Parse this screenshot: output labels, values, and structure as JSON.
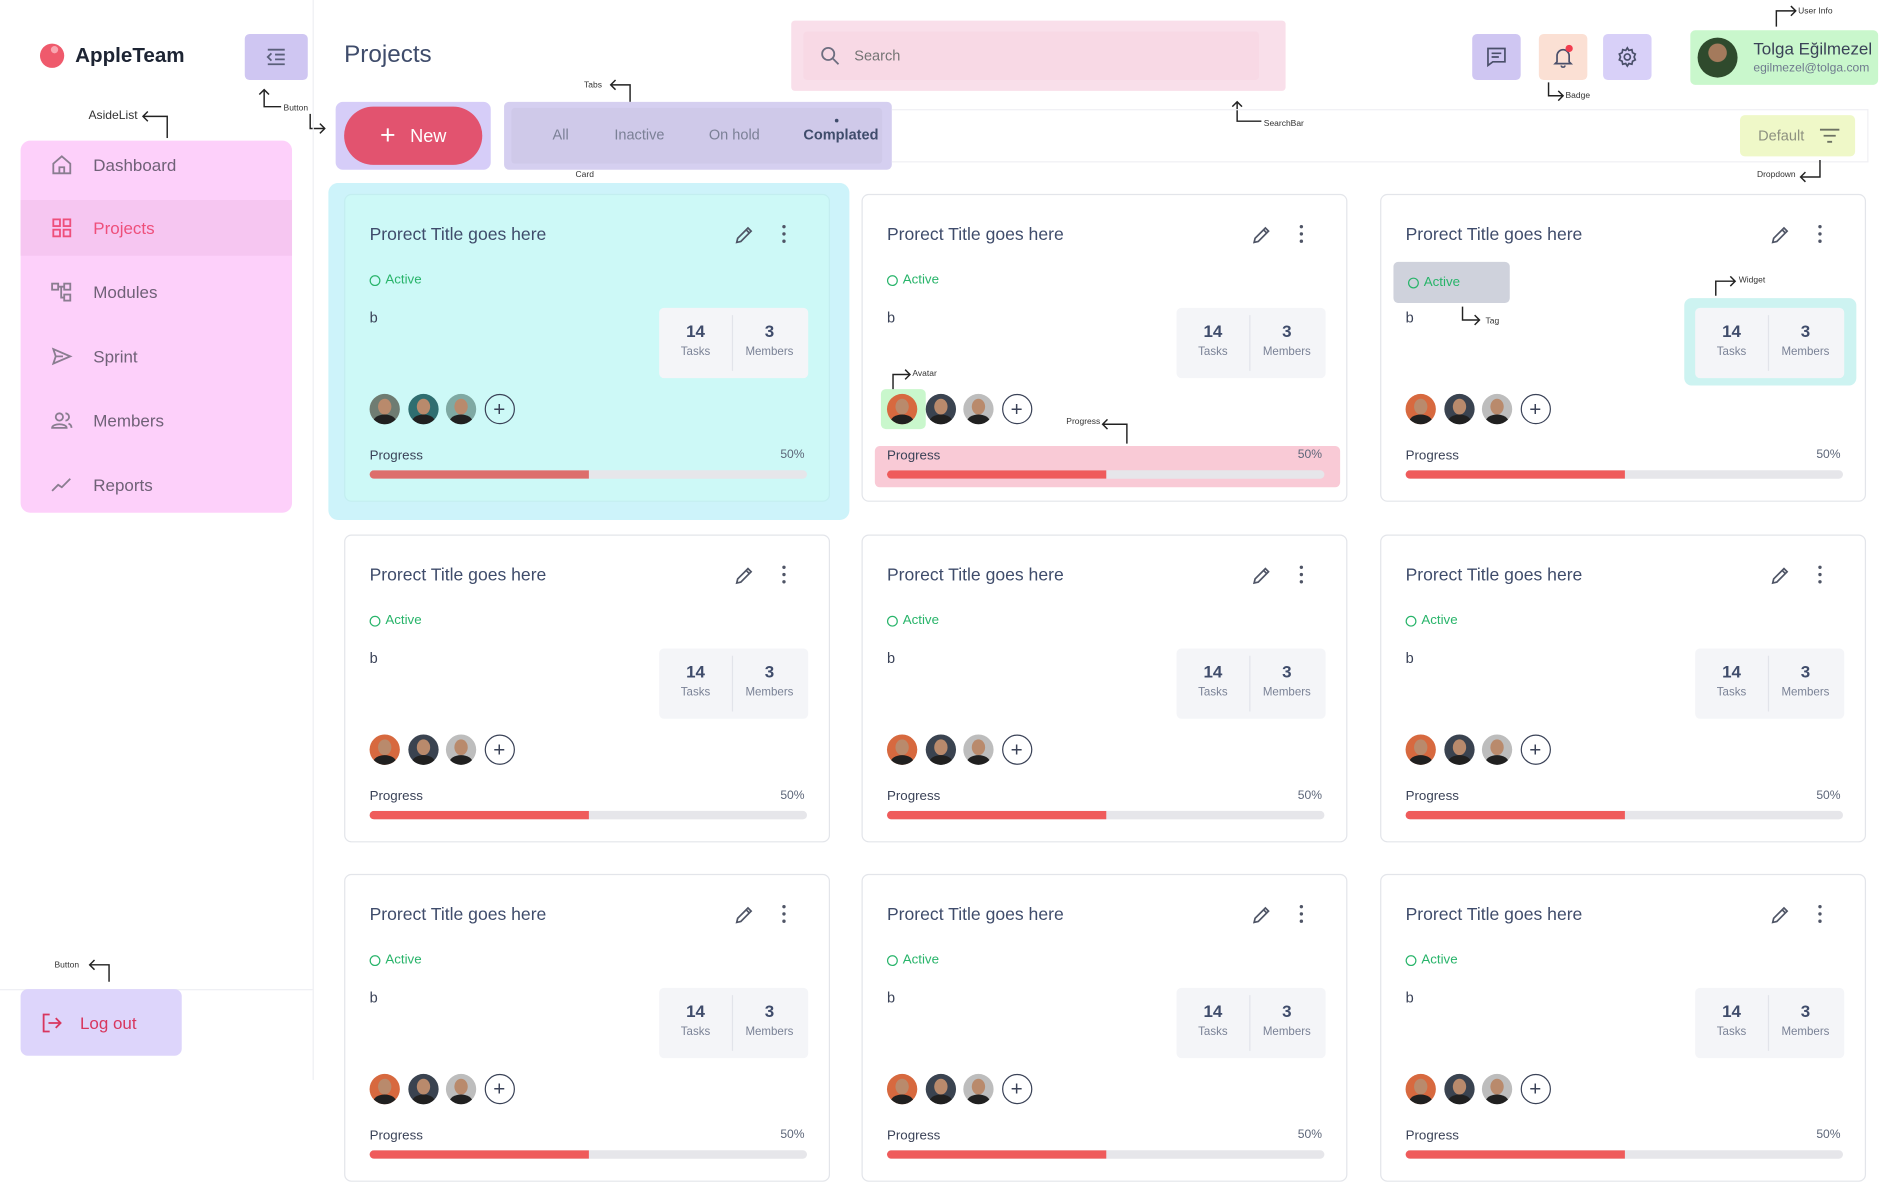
{
  "app": {
    "name": "AppleTeam"
  },
  "sidebar": {
    "items": [
      {
        "label": "Dashboard",
        "icon": "home-icon",
        "active": false
      },
      {
        "label": "Projects",
        "icon": "grid-icon",
        "active": true
      },
      {
        "label": "Modules",
        "icon": "modules-icon",
        "active": false
      },
      {
        "label": "Sprint",
        "icon": "send-icon",
        "active": false
      },
      {
        "label": "Members",
        "icon": "members-icon",
        "active": false
      },
      {
        "label": "Reports",
        "icon": "trend-icon",
        "active": false
      }
    ],
    "logout_label": "Log out"
  },
  "header": {
    "title": "Projects",
    "search": {
      "placeholder": "Search",
      "value": ""
    },
    "user": {
      "name": "Tolga Eğilmezel",
      "email": "egilmezel@tolga.com"
    }
  },
  "toolbar": {
    "new_label": "New",
    "tabs": [
      {
        "label": "All",
        "active": false
      },
      {
        "label": "Inactive",
        "active": false
      },
      {
        "label": "On hold",
        "active": false
      },
      {
        "label": "Complated",
        "active": true
      }
    ],
    "sort": {
      "value": "Default"
    }
  },
  "annotations": {
    "aside_list": "AsideList",
    "button_1": "Button",
    "button_2": "Button",
    "tabs": "Tabs",
    "card": "Card",
    "search_bar": "SearchBar",
    "badge": "Badge",
    "user_info": "User Info",
    "dropdown": "Dropdown",
    "widget": "Widget",
    "tag": "Tag",
    "avatar": "Avatar",
    "progress": "Progress"
  },
  "cards": [
    {
      "title": "Prorect Title goes here",
      "status": "Active",
      "description": "b",
      "tasks": "14",
      "tasks_label": "Tasks",
      "members": "3",
      "members_label": "Members",
      "progress_label": "Progress",
      "progress_text": "50%",
      "progress": 0.5
    },
    {
      "title": "Prorect Title goes here",
      "status": "Active",
      "description": "b",
      "tasks": "14",
      "tasks_label": "Tasks",
      "members": "3",
      "members_label": "Members",
      "progress_label": "Progress",
      "progress_text": "50%",
      "progress": 0.5
    },
    {
      "title": "Prorect Title goes here",
      "status": "Active",
      "description": "b",
      "tasks": "14",
      "tasks_label": "Tasks",
      "members": "3",
      "members_label": "Members",
      "progress_label": "Progress",
      "progress_text": "50%",
      "progress": 0.5
    },
    {
      "title": "Prorect Title goes here",
      "status": "Active",
      "description": "b",
      "tasks": "14",
      "tasks_label": "Tasks",
      "members": "3",
      "members_label": "Members",
      "progress_label": "Progress",
      "progress_text": "50%",
      "progress": 0.5
    },
    {
      "title": "Prorect Title goes here",
      "status": "Active",
      "description": "b",
      "tasks": "14",
      "tasks_label": "Tasks",
      "members": "3",
      "members_label": "Members",
      "progress_label": "Progress",
      "progress_text": "50%",
      "progress": 0.5
    },
    {
      "title": "Prorect Title goes here",
      "status": "Active",
      "description": "b",
      "tasks": "14",
      "tasks_label": "Tasks",
      "members": "3",
      "members_label": "Members",
      "progress_label": "Progress",
      "progress_text": "50%",
      "progress": 0.5
    },
    {
      "title": "Prorect Title goes here",
      "status": "Active",
      "description": "b",
      "tasks": "14",
      "tasks_label": "Tasks",
      "members": "3",
      "members_label": "Members",
      "progress_label": "Progress",
      "progress_text": "50%",
      "progress": 0.5
    },
    {
      "title": "Prorect Title goes here",
      "status": "Active",
      "description": "b",
      "tasks": "14",
      "tasks_label": "Tasks",
      "members": "3",
      "members_label": "Members",
      "progress_label": "Progress",
      "progress_text": "50%",
      "progress": 0.5
    },
    {
      "title": "Prorect Title goes here",
      "status": "Active",
      "description": "b",
      "tasks": "14",
      "tasks_label": "Tasks",
      "members": "3",
      "members_label": "Members",
      "progress_label": "Progress",
      "progress_text": "50%",
      "progress": 0.5
    }
  ],
  "colors": {
    "accent": "#e2536f",
    "active_status": "#28b46a",
    "progress_fill": "#ef5b5b"
  }
}
